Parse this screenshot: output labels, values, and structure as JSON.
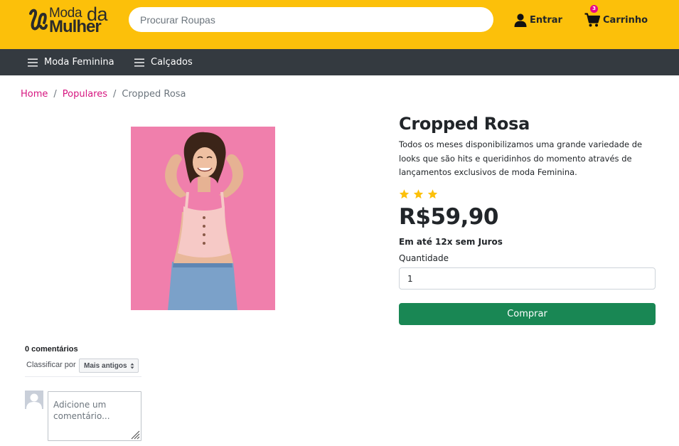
{
  "header": {
    "logo": {
      "line1": "Moda",
      "line2": "da",
      "line3": "Mulher"
    },
    "search_placeholder": "Procurar Roupas",
    "login_label": "Entrar",
    "cart_label": "Carrinho",
    "cart_count": "3"
  },
  "nav": {
    "items": [
      {
        "label": "Moda Feminina",
        "icon": "menu-icon"
      },
      {
        "label": "Calçados",
        "icon": "menu-icon"
      }
    ]
  },
  "breadcrumb": {
    "items": [
      "Home",
      "Populares"
    ],
    "current": "Cropped Rosa",
    "separator": "/"
  },
  "product": {
    "title": "Cropped Rosa",
    "description": "Todos os meses disponibilizamos uma grande variedade de looks que são hits e queridinhos do momento através de lançamentos exclusivos de moda Feminina.",
    "rating": 3,
    "price": "R$59,90",
    "installments": "Em até 12x sem Juros",
    "quantity_label": "Quantidade",
    "quantity_value": "1",
    "buy_label": "Comprar"
  },
  "comments": {
    "count_label": "0 comentários",
    "sort_label": "Classificar por",
    "sort_value": "Mais antigos",
    "input_placeholder": "Adicione um comentário..."
  },
  "colors": {
    "header_bg": "#fcc00a",
    "nav_bg": "#343a40",
    "link": "#d6157f",
    "buy_button": "#198754",
    "star": "#fcc00a",
    "badge": "#e8078a",
    "product_bg": "#f07fac"
  }
}
